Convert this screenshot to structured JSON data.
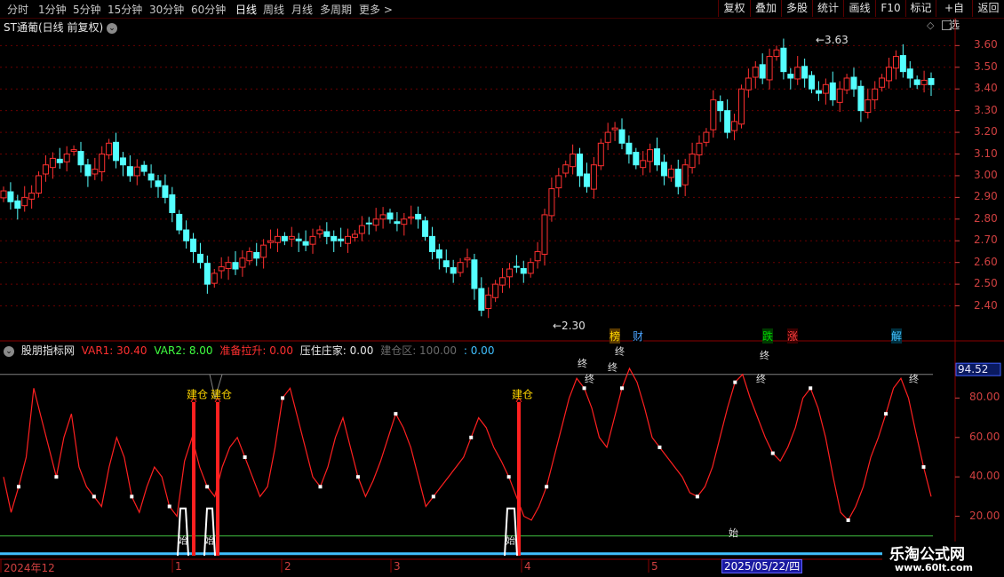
{
  "toolbar": {
    "timeframes": [
      "分时",
      "1分钟",
      "5分钟",
      "15分钟",
      "30分钟",
      "60分钟",
      "日线",
      "周线",
      "月线",
      "多周期",
      "更多 >"
    ],
    "active_timeframe": "日线",
    "right_buttons": [
      "复权",
      "叠加",
      "多股",
      "统计",
      "画线",
      "F10",
      "标记",
      "+自选",
      "返回"
    ]
  },
  "stock": {
    "title": "ST通葡(日线 前复权)"
  },
  "main_chart": {
    "price_axis": [
      "3.60",
      "3.50",
      "3.40",
      "3.30",
      "3.20",
      "3.10",
      "3.00",
      "2.90",
      "2.80",
      "2.70",
      "2.60",
      "2.50",
      "2.40"
    ],
    "high_label": "3.63",
    "low_label": "2.30",
    "event_tags": [
      {
        "text": "榜",
        "color": "#ffd700",
        "bg": "#5a3a00"
      },
      {
        "text": "财",
        "color": "#4aa3ff",
        "bg": "#000"
      },
      {
        "text": "跌",
        "color": "#00d000",
        "bg": "#003a00"
      },
      {
        "text": "涨",
        "color": "#ff4040",
        "bg": "#3a0000"
      },
      {
        "text": "解",
        "color": "#40c0ff",
        "bg": "#003040"
      }
    ],
    "up_color": "#ff3030",
    "down_color": "#54ffff"
  },
  "indicator": {
    "name": "股朋指标网",
    "var1_label": "VAR1: 30.40",
    "var2_label": "VAR2: 8.00",
    "zhunbei_label": "准备拉升: 0.00",
    "yazhu_label": "压住庄家: 0.00",
    "jiancang_label": "建仓区: 100.00",
    "last_label": ": 0.00",
    "axis_labels": [
      "80.00",
      "60.00",
      "40.00",
      "20.00"
    ],
    "current_value": "94.52",
    "build_label": "建仓",
    "end_label": "终",
    "start_label": "始"
  },
  "date_axis": {
    "labels": [
      "2024年12",
      "1",
      "2",
      "3",
      "4",
      "5"
    ],
    "highlight": "2025/05/22/四"
  },
  "watermark": {
    "line1": "乐淘公式网",
    "line2": "www.60lt.com"
  },
  "chart_data": [
    {
      "type": "candlestick",
      "title": "ST通葡(日线 前复权)",
      "ylim": [
        2.3,
        3.63
      ],
      "close_series": [
        2.93,
        2.88,
        2.85,
        2.9,
        2.92,
        3.0,
        3.05,
        3.08,
        3.06,
        3.1,
        3.12,
        3.05,
        3.0,
        3.03,
        3.1,
        3.15,
        3.07,
        3.05,
        3.0,
        3.04,
        3.02,
        2.98,
        2.95,
        2.9,
        2.83,
        2.75,
        2.7,
        2.65,
        2.6,
        2.5,
        2.55,
        2.58,
        2.6,
        2.57,
        2.62,
        2.65,
        2.62,
        2.68,
        2.7,
        2.72,
        2.7,
        2.72,
        2.7,
        2.68,
        2.72,
        2.75,
        2.72,
        2.7,
        2.7,
        2.72,
        2.73,
        2.77,
        2.78,
        2.8,
        2.82,
        2.8,
        2.78,
        2.8,
        2.81,
        2.8,
        2.72,
        2.65,
        2.62,
        2.58,
        2.55,
        2.6,
        2.62,
        2.48,
        2.38,
        2.45,
        2.5,
        2.53,
        2.57,
        2.58,
        2.55,
        2.6,
        2.65,
        2.82,
        2.94,
        3.0,
        3.05,
        3.1,
        3.0,
        2.95,
        3.05,
        3.15,
        3.2,
        3.22,
        3.15,
        3.1,
        3.05,
        3.07,
        3.12,
        3.05,
        3.0,
        3.03,
        2.95,
        3.05,
        3.1,
        3.15,
        3.2,
        3.35,
        3.3,
        3.2,
        3.25,
        3.4,
        3.45,
        3.5,
        3.45,
        3.55,
        3.58,
        3.48,
        3.45,
        3.5,
        3.45,
        3.4,
        3.38,
        3.42,
        3.35,
        3.4,
        3.45,
        3.4,
        3.3,
        3.35,
        3.4,
        3.45,
        3.5,
        3.55,
        3.48,
        3.45,
        3.42,
        3.44,
        3.42
      ]
    },
    {
      "type": "line",
      "title": "股朋指标网",
      "ylim": [
        0,
        100
      ],
      "series": [
        {
          "name": "VAR1",
          "values": [
            40,
            22,
            35,
            50,
            85,
            70,
            55,
            40,
            60,
            72,
            45,
            35,
            30,
            25,
            45,
            60,
            50,
            30,
            22,
            35,
            45,
            40,
            25,
            20,
            48,
            60,
            45,
            35,
            30,
            45,
            55,
            60,
            50,
            40,
            30,
            35,
            55,
            80,
            85,
            70,
            55,
            40,
            35,
            45,
            60,
            70,
            55,
            40,
            30,
            38,
            48,
            60,
            72,
            65,
            55,
            40,
            25,
            30,
            35,
            40,
            45,
            50,
            60,
            70,
            65,
            55,
            48,
            40,
            30,
            20,
            18,
            25,
            35,
            50,
            65,
            80,
            90,
            85,
            75,
            60,
            55,
            70,
            85,
            95,
            88,
            75,
            60,
            55,
            50,
            45,
            40,
            32,
            30,
            35,
            45,
            60,
            75,
            88,
            92,
            80,
            70,
            60,
            52,
            48,
            55,
            65,
            80,
            85,
            75,
            60,
            40,
            22,
            18,
            25,
            35,
            50,
            60,
            72,
            85,
            90,
            80,
            62,
            45,
            30
          ]
        }
      ]
    }
  ]
}
